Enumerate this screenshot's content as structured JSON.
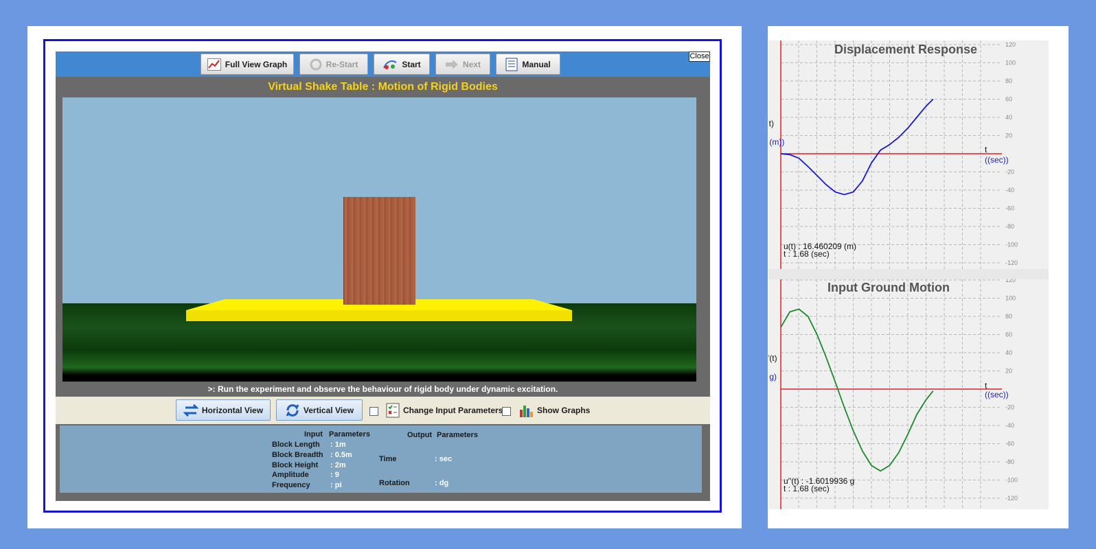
{
  "toolbar": {
    "buttons": [
      {
        "label": "Full View Graph",
        "icon": "graph-icon",
        "enabled": true
      },
      {
        "label": "Re-Start",
        "icon": "restart-icon",
        "enabled": false
      },
      {
        "label": "Start",
        "icon": "start-icon",
        "enabled": true
      },
      {
        "label": "Next",
        "icon": "next-arrow-icon",
        "enabled": false
      },
      {
        "label": "Manual",
        "icon": "manual-icon",
        "enabled": true
      }
    ],
    "close_label": "Close"
  },
  "simulation": {
    "title": "Virtual Shake Table : Motion of Rigid Bodies",
    "hint": ">: Run the experiment and observe the behaviour of rigid body under dynamic excitation.",
    "colors": {
      "title": "#f6d21b",
      "table": "#fff200",
      "block": "#a55b3a",
      "sky": "#8eb8d4"
    }
  },
  "controls": {
    "horizontal_view": "Horizontal View",
    "vertical_view": "Vertical View",
    "change_input": "Change Input Parameters",
    "show_graphs": "Show Graphs",
    "change_input_checked": false,
    "show_graphs_checked": false
  },
  "parameters": {
    "input_header": "Input",
    "input_header2": "Parameters",
    "output_header": "Output",
    "output_header2": "Parameters",
    "inputs": [
      {
        "name": "Block Length",
        "value": ": 1m"
      },
      {
        "name": "Block Breadth",
        "value": ": 0.5m"
      },
      {
        "name": "Block Height",
        "value": ": 2m"
      },
      {
        "name": "Amplitude",
        "value": ": 9"
      },
      {
        "name": "Frequency",
        "value": ": pi"
      }
    ],
    "outputs": [
      {
        "name": "Time",
        "value": ": sec"
      },
      {
        "name": "Rotation",
        "value": ": dg"
      }
    ]
  },
  "graphs": {
    "displacement": {
      "title": "Displacement Response",
      "ylabel": "u(t)",
      "yunit": "( (m))",
      "xlabel": "t",
      "xunit": "((sec))",
      "readout_value": "u(t) : 16.460209  (m)",
      "readout_time": "t : 1.68 (sec)",
      "ticks": [
        "120",
        "100",
        "80",
        "60",
        "40",
        "20",
        "-20",
        "-40",
        "-60",
        "-80",
        "-100",
        "-120"
      ],
      "curve_color": "#1515dd"
    },
    "ground": {
      "title": "Input Ground Motion",
      "ylabel": "u''(t)",
      "yunit": "( g)",
      "xlabel": "t",
      "xunit": "((sec))",
      "readout_value": "u''(t) : -1.6019936  g",
      "readout_time": "t : 1.68 (sec)",
      "ticks": [
        "120",
        "100",
        "80",
        "60",
        "40",
        "20",
        "-20",
        "-40",
        "-60",
        "-80",
        "-100",
        "-120"
      ],
      "curve_color": "#1a8a2a"
    },
    "axis_color": "#e02020"
  },
  "chart_data": [
    {
      "type": "line",
      "title": "Displacement Response",
      "xlabel": "t",
      "ylabel": "u(t)",
      "ylim": [
        -120,
        120
      ],
      "grid": true,
      "series": [
        {
          "x": [
            0,
            0.1,
            0.2,
            0.3,
            0.4,
            0.5,
            0.6,
            0.7,
            0.8,
            0.9,
            1.0,
            1.1,
            1.2,
            1.3,
            1.4,
            1.5,
            1.6,
            1.68
          ],
          "values": [
            0,
            -1,
            -5,
            -14,
            -24,
            -34,
            -42,
            -45,
            -42,
            -30,
            -10,
            4,
            10,
            18,
            28,
            40,
            52,
            60
          ]
        }
      ]
    },
    {
      "type": "line",
      "title": "Input Ground Motion",
      "xlabel": "t",
      "ylabel": "u''(t)",
      "ylim": [
        -120,
        120
      ],
      "grid": true,
      "series": [
        {
          "x": [
            0,
            0.1,
            0.2,
            0.3,
            0.4,
            0.5,
            0.6,
            0.7,
            0.8,
            0.9,
            1.0,
            1.1,
            1.2,
            1.3,
            1.4,
            1.5,
            1.6,
            1.68
          ],
          "values": [
            68,
            85,
            88,
            80,
            60,
            35,
            8,
            -20,
            -46,
            -68,
            -84,
            -90,
            -84,
            -70,
            -50,
            -28,
            -12,
            -2
          ]
        }
      ]
    }
  ]
}
